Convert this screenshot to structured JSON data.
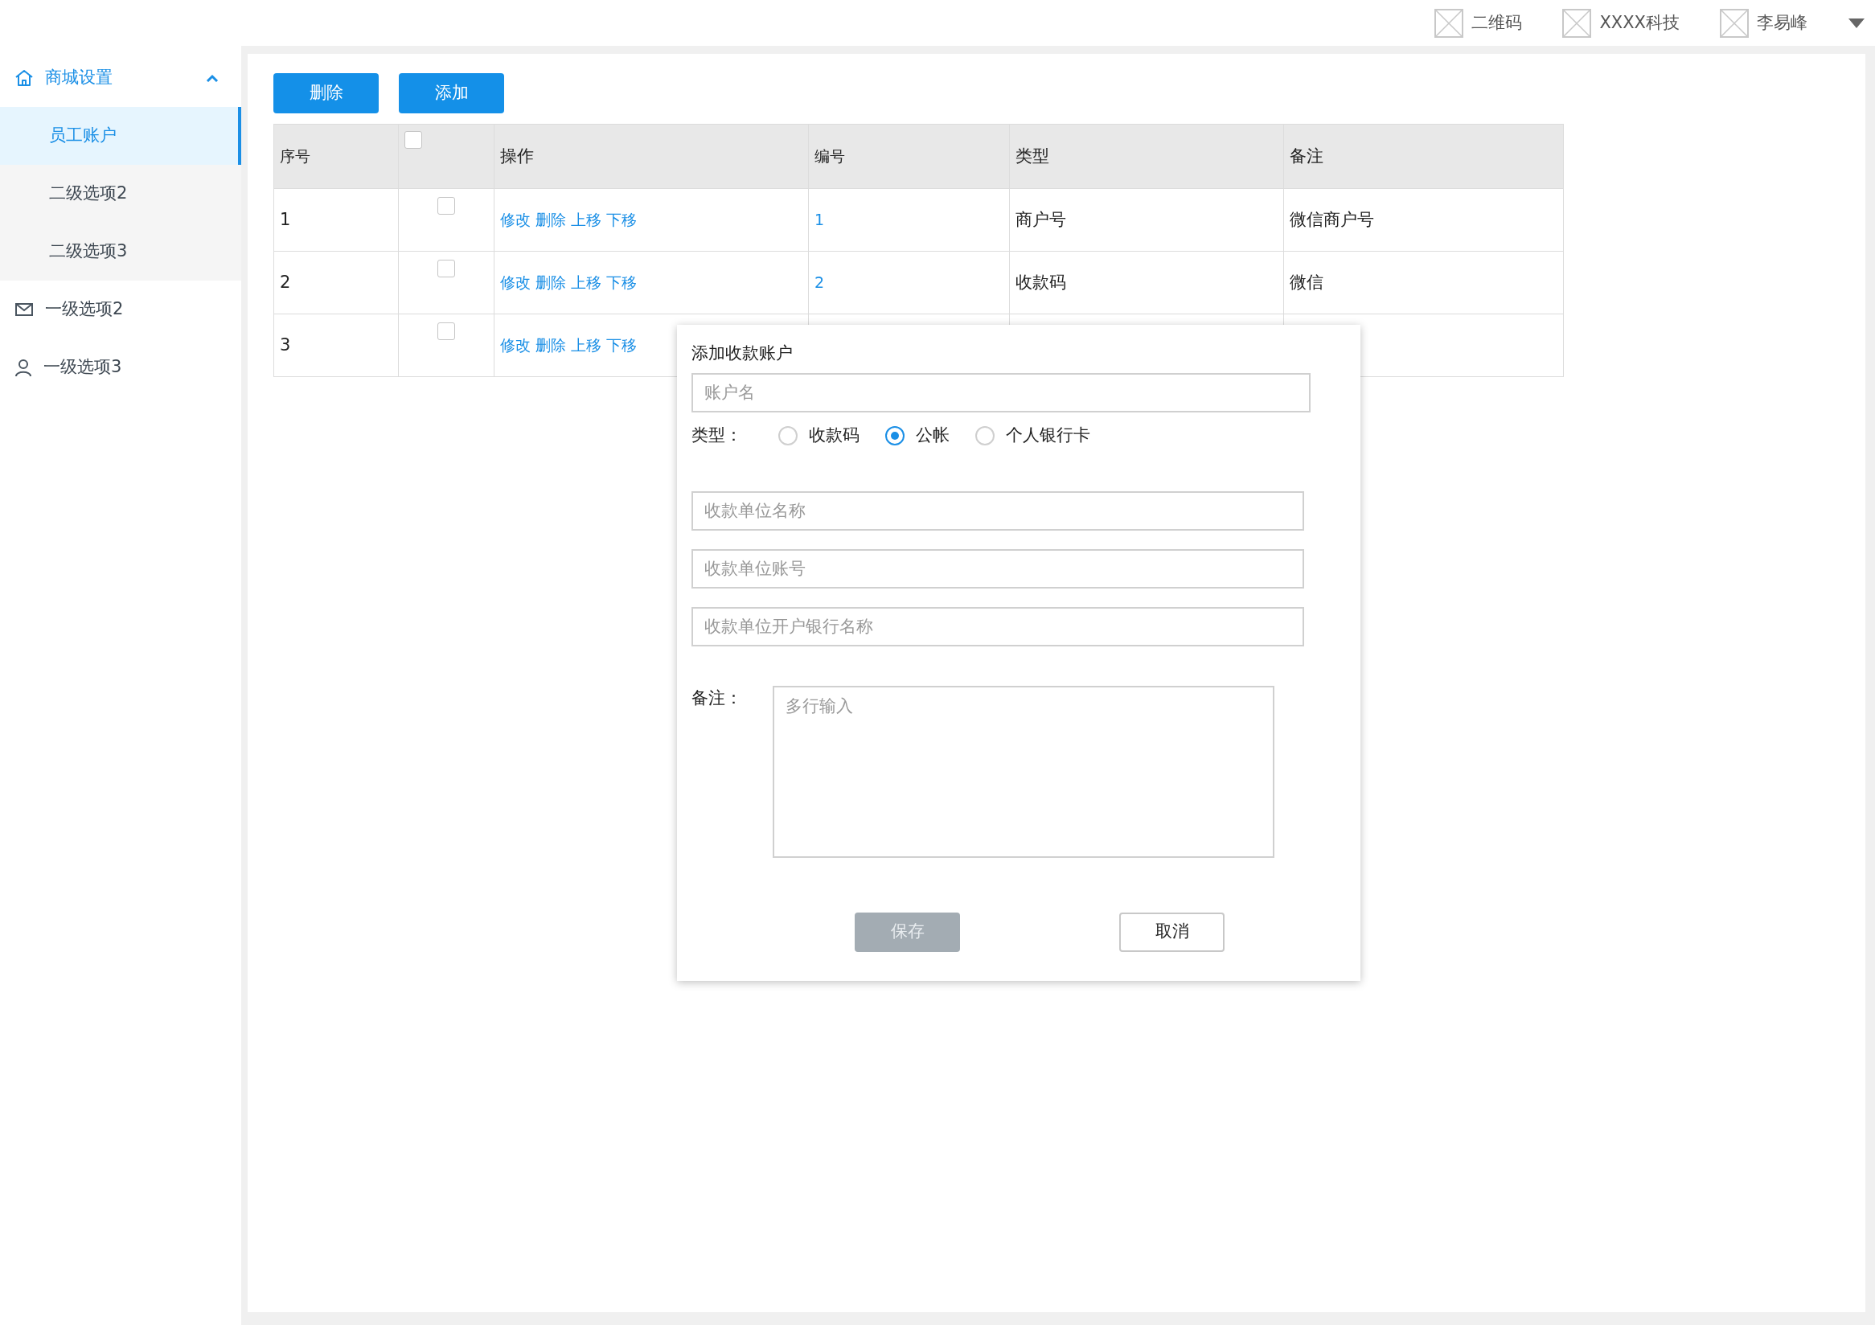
{
  "header": {
    "items": [
      {
        "label": "二维码"
      },
      {
        "label": "XXXX科技"
      },
      {
        "label": "李易峰"
      }
    ]
  },
  "sidebar": {
    "items": [
      {
        "label": "商城设置",
        "expanded": true,
        "children": [
          {
            "label": "员工账户",
            "selected": true
          },
          {
            "label": "二级选项2",
            "selected": false
          },
          {
            "label": "二级选项3",
            "selected": false
          }
        ]
      },
      {
        "label": "一级选项2"
      },
      {
        "label": "一级选项3"
      }
    ]
  },
  "toolbar": {
    "buttons": [
      "删除",
      "添加"
    ]
  },
  "table": {
    "columns": [
      {
        "kind": "text",
        "label": "序号"
      },
      {
        "kind": "checkbox",
        "checked": false
      },
      {
        "kind": "text",
        "label": "操作"
      },
      {
        "kind": "text",
        "label": "编号"
      },
      {
        "kind": "text",
        "label": "类型"
      },
      {
        "kind": "text",
        "label": "备注"
      }
    ],
    "rows": [
      {
        "index": "1",
        "checked": false,
        "actions": [
          "修改",
          "删除",
          "上移",
          "下移"
        ],
        "number": "1",
        "type": "商户号",
        "note": "微信商户号"
      },
      {
        "index": "2",
        "checked": false,
        "actions": [
          "修改",
          "删除",
          "上移",
          "下移"
        ],
        "number": "2",
        "type": "收款码",
        "note": "微信"
      },
      {
        "index": "3",
        "checked": false,
        "actions": [
          "修改",
          "删除",
          "上移",
          "下移"
        ]
      }
    ]
  },
  "dialog": {
    "title": "添加收款账户",
    "account_field": {
      "placeholder": "账户名"
    },
    "type_label": "类型：",
    "type_options": [
      {
        "label": "收款码",
        "selected": false
      },
      {
        "label": "公帐",
        "selected": true
      },
      {
        "label": "个人银行卡",
        "selected": false
      }
    ],
    "fields": [
      {
        "placeholder": "收款单位名称"
      },
      {
        "placeholder": "收款单位账号"
      },
      {
        "placeholder": "收款单位开户银行名称"
      }
    ],
    "note_label": "备注：",
    "note_field": {
      "placeholder": "多行输入"
    },
    "buttons": [
      {
        "label": "保存",
        "kind": "primary",
        "disabled": true
      },
      {
        "label": "取消",
        "kind": "secondary",
        "disabled": false
      }
    ]
  }
}
